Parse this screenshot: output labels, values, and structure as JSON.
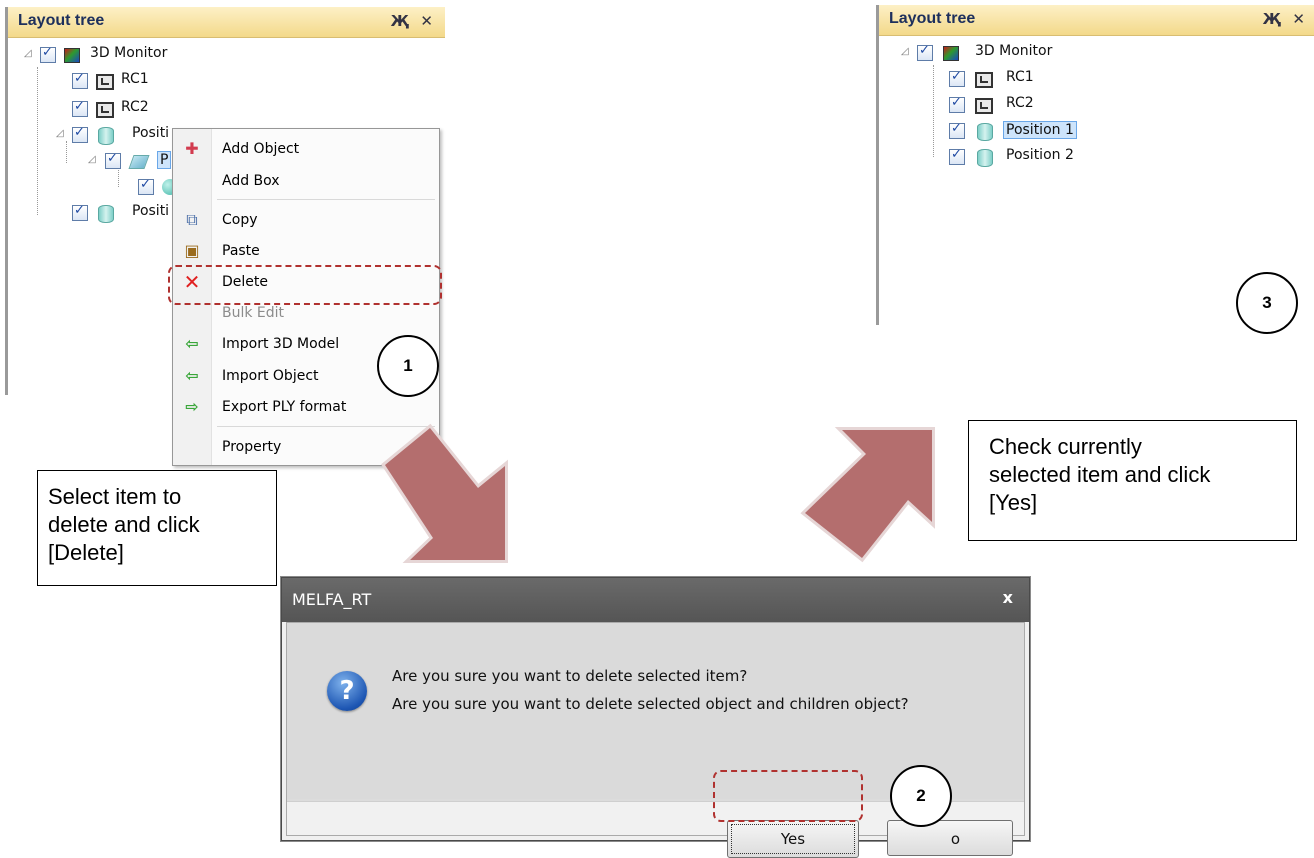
{
  "left_panel": {
    "title": "Layout tree",
    "pin_glyph": "Җ",
    "close_glyph": "✕",
    "items": [
      {
        "label": "3D Monitor",
        "icon": "monitor-icon"
      },
      {
        "label": "RC1",
        "icon": "robot-controller-icon"
      },
      {
        "label": "RC2",
        "icon": "robot-controller-icon"
      },
      {
        "label": "Positi",
        "icon": "cylinder-icon"
      },
      {
        "label": "P",
        "icon": "workpiece-icon"
      },
      {
        "label": "",
        "icon": "ball-icon"
      },
      {
        "label": "Positi",
        "icon": "cylinder-icon"
      }
    ]
  },
  "context_menu": {
    "items": [
      {
        "label": "Add Object",
        "icon": "add-object-icon"
      },
      {
        "label": "Add Box",
        "icon": ""
      },
      {
        "label": "Copy",
        "icon": "copy-icon"
      },
      {
        "label": "Paste",
        "icon": "paste-icon"
      },
      {
        "label": "Delete",
        "icon": "delete-icon",
        "highlighted": true
      },
      {
        "label": "Bulk Edit",
        "icon": "",
        "disabled": true
      },
      {
        "label": "Import 3D Model",
        "icon": "import-arrow-icon"
      },
      {
        "label": "Import Object",
        "icon": "import-arrow-icon"
      },
      {
        "label": "Export PLY format",
        "icon": "export-arrow-icon"
      },
      {
        "label": "Property",
        "icon": ""
      }
    ]
  },
  "step_numbers": {
    "one": "1",
    "two": "2",
    "three": "3"
  },
  "callouts": {
    "left": "Select item to\ndelete and click\n[Delete]",
    "right": "Check currently\nselected item and click\n[Yes]"
  },
  "right_panel": {
    "title": "Layout tree",
    "pin_glyph": "Җ",
    "close_glyph": "✕",
    "items": [
      {
        "label": "3D Monitor",
        "icon": "monitor-icon"
      },
      {
        "label": "RC1",
        "icon": "robot-controller-icon"
      },
      {
        "label": "RC2",
        "icon": "robot-controller-icon"
      },
      {
        "label": "Position 1",
        "icon": "cylinder-icon",
        "selected": true
      },
      {
        "label": "Position 2",
        "icon": "cylinder-icon"
      }
    ]
  },
  "dialog": {
    "title": "MELFA_RT",
    "close_glyph": "x",
    "message_line1": "Are you sure you want to delete selected item?",
    "message_line2": "Are you sure you want to delete selected object and children object?",
    "yes_label": "Yes",
    "no_label": "o"
  },
  "colors": {
    "arrow": "#b46e6e",
    "dashed_highlight": "#b0312f",
    "panel_header": "#f3d98a",
    "dialog_title_bar": "#5f5f5f"
  }
}
